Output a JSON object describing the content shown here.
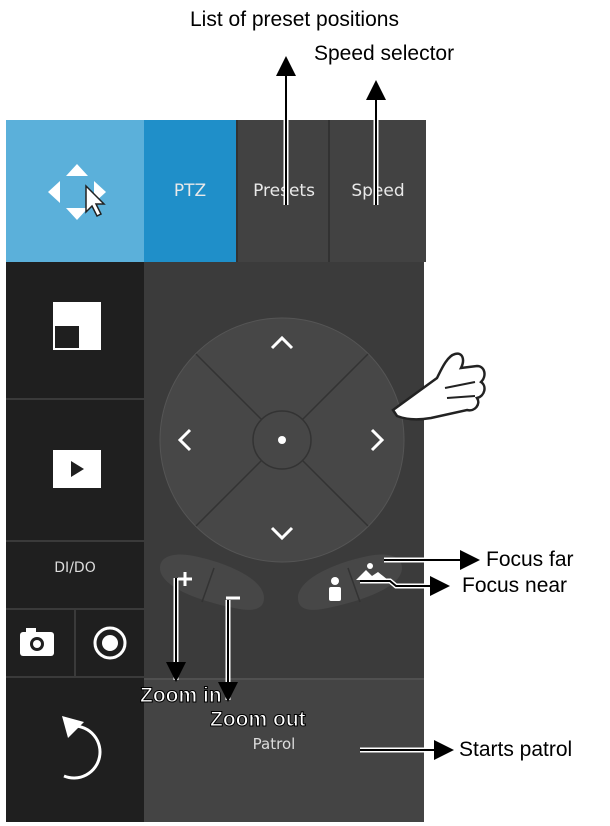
{
  "annotations": {
    "presets": "List of preset positions",
    "speed": "Speed selector",
    "focus_far": "Focus far",
    "focus_near": "Focus near",
    "patrol": "Starts patrol",
    "zoom_in": "Zoom in",
    "zoom_out": "Zoom out"
  },
  "tabs": {
    "ptz": "PTZ",
    "presets": "Presets",
    "speed": "Speed"
  },
  "sidebar": {
    "dido": "DI/DO"
  },
  "patrol": {
    "label": "Patrol"
  },
  "colors": {
    "accent_light": "#5bb0da",
    "accent": "#1f8fc9"
  },
  "icons": [
    "move-icon",
    "cursor-icon",
    "layout-icon",
    "play-icon",
    "camera-icon",
    "record-icon",
    "back-icon",
    "pan-up-icon",
    "pan-down-icon",
    "pan-left-icon",
    "pan-right-icon",
    "zoom-in-icon",
    "zoom-out-icon",
    "focus-near-icon",
    "focus-far-icon",
    "hand-pointer-icon"
  ]
}
